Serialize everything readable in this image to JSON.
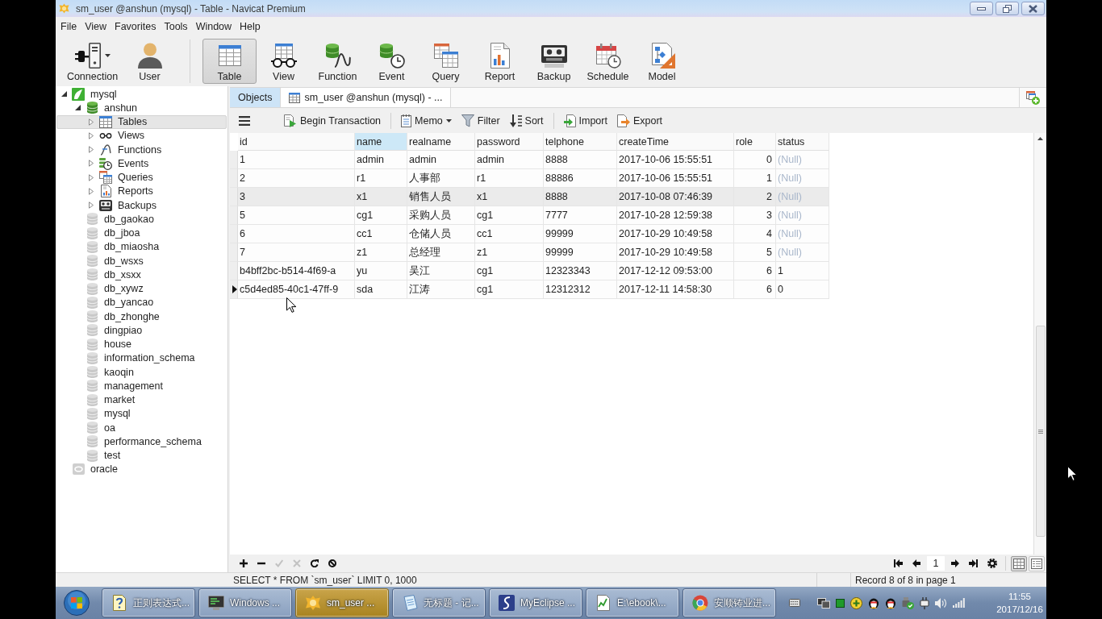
{
  "window": {
    "title": "sm_user @anshun (mysql) - Table - Navicat Premium"
  },
  "menu": [
    "File",
    "View",
    "Favorites",
    "Tools",
    "Window",
    "Help"
  ],
  "toolbar": {
    "groups": [
      {
        "items": [
          {
            "label": "Connection",
            "kind": "connection",
            "selected": false,
            "has_menu": true
          },
          {
            "label": "User",
            "kind": "user",
            "selected": false,
            "has_menu": false
          }
        ]
      },
      {
        "items": [
          {
            "label": "Table",
            "kind": "table",
            "selected": true,
            "has_menu": false
          },
          {
            "label": "View",
            "kind": "view",
            "selected": false,
            "has_menu": false
          },
          {
            "label": "Function",
            "kind": "function",
            "selected": false,
            "has_menu": false
          },
          {
            "label": "Event",
            "kind": "event",
            "selected": false,
            "has_menu": false
          },
          {
            "label": "Query",
            "kind": "query",
            "selected": false,
            "has_menu": false
          },
          {
            "label": "Report",
            "kind": "report",
            "selected": false,
            "has_menu": false
          },
          {
            "label": "Backup",
            "kind": "backup",
            "selected": false,
            "has_menu": false
          },
          {
            "label": "Schedule",
            "kind": "schedule",
            "selected": false,
            "has_menu": false
          },
          {
            "label": "Model",
            "kind": "model",
            "selected": false,
            "has_menu": false
          }
        ]
      }
    ]
  },
  "navigator": {
    "tree": [
      {
        "label": "mysql",
        "kind": "mysql",
        "open": true,
        "expanded": true,
        "selected": false,
        "children": [
          {
            "label": "anshun",
            "kind": "database",
            "open": true,
            "expanded": true,
            "selected": false,
            "children": [
              {
                "label": "Tables",
                "kind": "tables",
                "expanded": false,
                "selected": true
              },
              {
                "label": "Views",
                "kind": "views",
                "expanded": false,
                "selected": false
              },
              {
                "label": "Functions",
                "kind": "functions",
                "expanded": false,
                "selected": false
              },
              {
                "label": "Events",
                "kind": "events",
                "expanded": false,
                "selected": false
              },
              {
                "label": "Queries",
                "kind": "queries",
                "expanded": false,
                "selected": false
              },
              {
                "label": "Reports",
                "kind": "reports",
                "expanded": false,
                "selected": false
              },
              {
                "label": "Backups",
                "kind": "backups",
                "expanded": false,
                "selected": false
              }
            ]
          },
          {
            "label": "db_gaokao",
            "kind": "database",
            "open": false,
            "selected": false
          },
          {
            "label": "db_jboa",
            "kind": "database",
            "open": false,
            "selected": false
          },
          {
            "label": "db_miaosha",
            "kind": "database",
            "open": false,
            "selected": false
          },
          {
            "label": "db_wsxs",
            "kind": "database",
            "open": false,
            "selected": false
          },
          {
            "label": "db_xsxx",
            "kind": "database",
            "open": false,
            "selected": false
          },
          {
            "label": "db_xywz",
            "kind": "database",
            "open": false,
            "selected": false
          },
          {
            "label": "db_yancao",
            "kind": "database",
            "open": false,
            "selected": false
          },
          {
            "label": "db_zhonghe",
            "kind": "database",
            "open": false,
            "selected": false
          },
          {
            "label": "dingpiao",
            "kind": "database",
            "open": false,
            "selected": false
          },
          {
            "label": "house",
            "kind": "database",
            "open": false,
            "selected": false
          },
          {
            "label": "information_schema",
            "kind": "database",
            "open": false,
            "selected": false
          },
          {
            "label": "kaoqin",
            "kind": "database",
            "open": false,
            "selected": false
          },
          {
            "label": "management",
            "kind": "database",
            "open": false,
            "selected": false
          },
          {
            "label": "market",
            "kind": "database",
            "open": false,
            "selected": false
          },
          {
            "label": "mysql",
            "kind": "database",
            "open": false,
            "selected": false
          },
          {
            "label": "oa",
            "kind": "database",
            "open": false,
            "selected": false
          },
          {
            "label": "performance_schema",
            "kind": "database",
            "open": false,
            "selected": false
          },
          {
            "label": "test",
            "kind": "database",
            "open": false,
            "selected": false
          }
        ]
      },
      {
        "label": "oracle",
        "kind": "oracle",
        "open": false,
        "selected": false
      }
    ]
  },
  "tabs": [
    {
      "label": "Objects",
      "kind": "objects",
      "selected": false
    },
    {
      "label": "sm_user @anshun (mysql) - ...",
      "kind": "table",
      "selected": true
    }
  ],
  "data_toolbar": {
    "groups": [
      {
        "items": [
          {
            "kind": "menu"
          },
          {
            "label": "Begin Transaction",
            "kind": "transaction",
            "has_menu": false
          }
        ]
      },
      {
        "items": [
          {
            "label": "Memo",
            "kind": "memo",
            "has_menu": true
          },
          {
            "label": "Filter",
            "kind": "filter",
            "has_menu": false
          },
          {
            "label": "Sort",
            "kind": "sort",
            "has_menu": false
          }
        ]
      },
      {
        "items": [
          {
            "label": "Import",
            "kind": "import",
            "has_menu": false
          },
          {
            "label": "Export",
            "kind": "export",
            "has_menu": false
          }
        ]
      }
    ]
  },
  "grid": {
    "columns": [
      {
        "label": "id",
        "kind": "text",
        "selected": false
      },
      {
        "label": "name",
        "kind": "text",
        "selected": true
      },
      {
        "label": "realname",
        "kind": "text",
        "selected": false
      },
      {
        "label": "password",
        "kind": "text",
        "selected": false
      },
      {
        "label": "telphone",
        "kind": "text",
        "selected": false
      },
      {
        "label": "createTime",
        "kind": "text",
        "selected": false
      },
      {
        "label": "role",
        "kind": "number",
        "selected": false
      },
      {
        "label": "status",
        "kind": "text",
        "selected": false
      }
    ],
    "rows": [
      {
        "current": false,
        "highlighted": false,
        "cells": [
          {
            "text": "1",
            "null": false
          },
          {
            "text": "admin",
            "null": false
          },
          {
            "text": "admin",
            "null": false
          },
          {
            "text": "admin",
            "null": false
          },
          {
            "text": "8888",
            "null": false
          },
          {
            "text": "2017-10-06 15:55:51",
            "null": false
          },
          {
            "text": "0",
            "null": false
          },
          {
            "text": "(Null)",
            "null": true
          }
        ]
      },
      {
        "current": false,
        "highlighted": false,
        "cells": [
          {
            "text": "2",
            "null": false
          },
          {
            "text": "r1",
            "null": false
          },
          {
            "text": "人事部",
            "null": false
          },
          {
            "text": "r1",
            "null": false
          },
          {
            "text": "88886",
            "null": false
          },
          {
            "text": "2017-10-06 15:55:51",
            "null": false
          },
          {
            "text": "1",
            "null": false
          },
          {
            "text": "(Null)",
            "null": true
          }
        ]
      },
      {
        "current": false,
        "highlighted": true,
        "cells": [
          {
            "text": "3",
            "null": false
          },
          {
            "text": "x1",
            "null": false
          },
          {
            "text": "销售人员",
            "null": false
          },
          {
            "text": "x1",
            "null": false
          },
          {
            "text": "8888",
            "null": false
          },
          {
            "text": "2017-10-08 07:46:39",
            "null": false
          },
          {
            "text": "2",
            "null": false
          },
          {
            "text": "(Null)",
            "null": true
          }
        ]
      },
      {
        "current": false,
        "highlighted": false,
        "cells": [
          {
            "text": "5",
            "null": false
          },
          {
            "text": "cg1",
            "null": false
          },
          {
            "text": "采购人员",
            "null": false
          },
          {
            "text": "cg1",
            "null": false
          },
          {
            "text": "7777",
            "null": false
          },
          {
            "text": "2017-10-28 12:59:38",
            "null": false
          },
          {
            "text": "3",
            "null": false
          },
          {
            "text": "(Null)",
            "null": true
          }
        ]
      },
      {
        "current": false,
        "highlighted": false,
        "cells": [
          {
            "text": "6",
            "null": false
          },
          {
            "text": "cc1",
            "null": false
          },
          {
            "text": "仓储人员",
            "null": false
          },
          {
            "text": "cc1",
            "null": false
          },
          {
            "text": "99999",
            "null": false
          },
          {
            "text": "2017-10-29 10:49:58",
            "null": false
          },
          {
            "text": "4",
            "null": false
          },
          {
            "text": "(Null)",
            "null": true
          }
        ]
      },
      {
        "current": false,
        "highlighted": false,
        "cells": [
          {
            "text": "7",
            "null": false
          },
          {
            "text": "z1",
            "null": false
          },
          {
            "text": "总经理",
            "null": false
          },
          {
            "text": "z1",
            "null": false
          },
          {
            "text": "99999",
            "null": false
          },
          {
            "text": "2017-10-29 10:49:58",
            "null": false
          },
          {
            "text": "5",
            "null": false
          },
          {
            "text": "(Null)",
            "null": true
          }
        ]
      },
      {
        "current": false,
        "highlighted": false,
        "cells": [
          {
            "text": "b4bff2bc-b514-4f69-a",
            "null": false
          },
          {
            "text": "yu",
            "null": false
          },
          {
            "text": "吴江",
            "null": false
          },
          {
            "text": "cg1",
            "null": false
          },
          {
            "text": "12323343",
            "null": false
          },
          {
            "text": "2017-12-12 09:53:00",
            "null": false
          },
          {
            "text": "6",
            "null": false
          },
          {
            "text": "1",
            "null": false
          }
        ]
      },
      {
        "current": true,
        "highlighted": false,
        "cells": [
          {
            "text": "c5d4ed85-40c1-47ff-9",
            "null": false
          },
          {
            "text": "sda",
            "null": false
          },
          {
            "text": "江涛",
            "null": false
          },
          {
            "text": "cg1",
            "null": false
          },
          {
            "text": "12312312",
            "null": false
          },
          {
            "text": "2017-12-11 14:58:30",
            "null": false
          },
          {
            "text": "6",
            "null": false
          },
          {
            "text": "0",
            "null": false
          }
        ]
      }
    ]
  },
  "record_nav": {
    "edit_buttons": [
      {
        "kind": "add",
        "disabled": false
      },
      {
        "kind": "delete",
        "disabled": false
      },
      {
        "kind": "apply",
        "disabled": true
      },
      {
        "kind": "discard",
        "disabled": true
      },
      {
        "kind": "refresh",
        "disabled": false
      },
      {
        "kind": "stop",
        "disabled": false
      }
    ],
    "page": "1",
    "view_modes": [
      {
        "kind": "grid",
        "selected": true
      },
      {
        "kind": "form",
        "selected": false
      }
    ]
  },
  "status_bar": {
    "query": "SELECT * FROM `sm_user` LIMIT 0, 1000",
    "record": "Record 8 of 8 in page 1"
  },
  "taskbar": {
    "items": [
      {
        "label": "正则表达式...",
        "kind": "help",
        "selected": false
      },
      {
        "label": "Windows ...",
        "kind": "monitor",
        "selected": false
      },
      {
        "label": "sm_user ...",
        "kind": "sun",
        "selected": true
      },
      {
        "label": "无标题 - 记...",
        "kind": "notepad",
        "selected": false
      },
      {
        "label": "MyEclipse ...",
        "kind": "curve",
        "selected": false
      },
      {
        "label": "E:\\ebook\\...",
        "kind": "chart",
        "selected": false
      },
      {
        "label": "安顺铸业进...",
        "kind": "ring",
        "selected": false
      }
    ],
    "time": "11:55",
    "date": "2017/12/16"
  }
}
